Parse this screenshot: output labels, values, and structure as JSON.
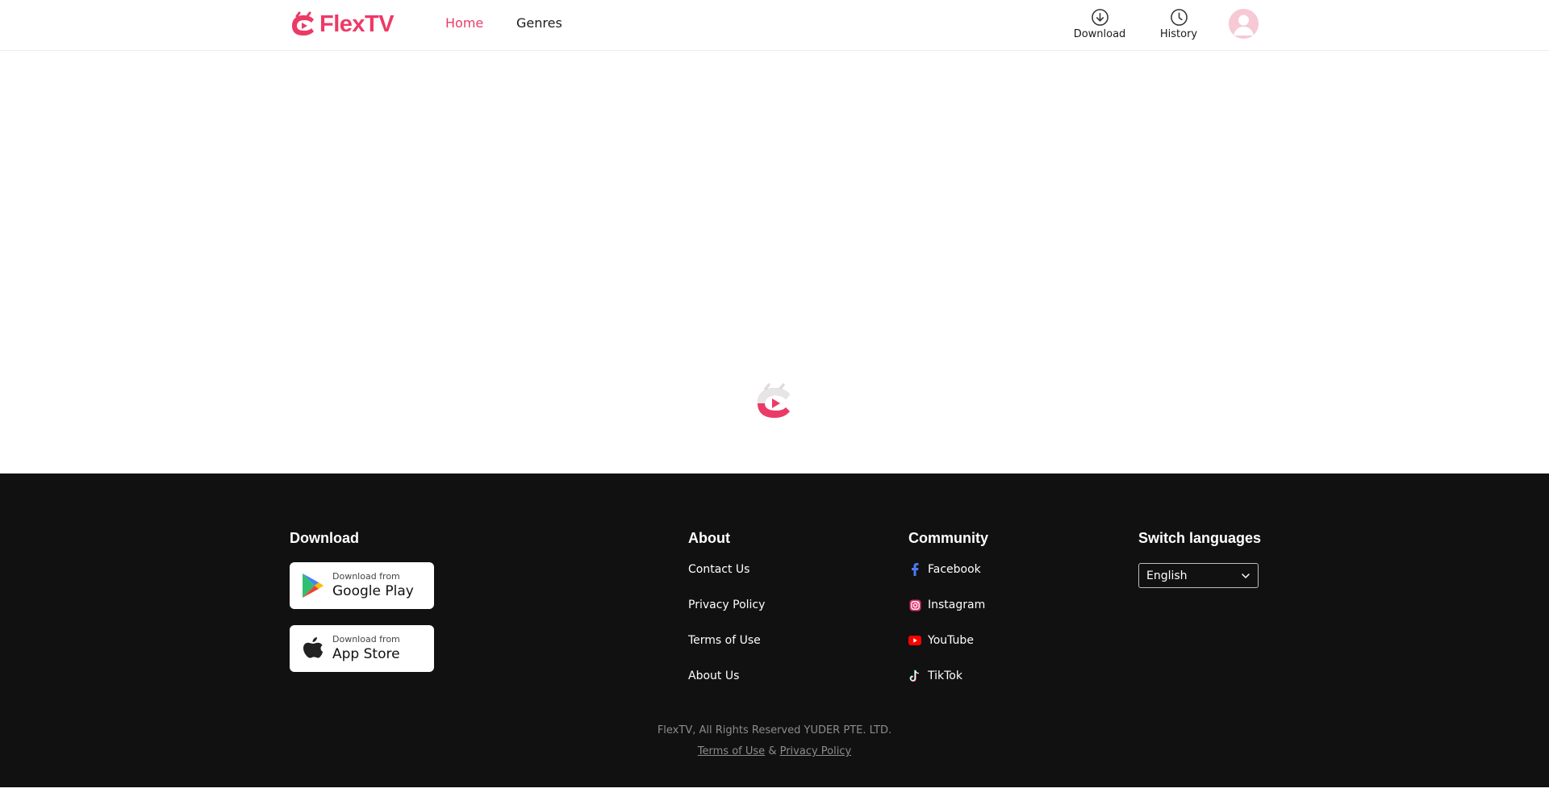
{
  "header": {
    "brand": "FlexTV",
    "nav": [
      {
        "label": "Home",
        "active": true
      },
      {
        "label": "Genres",
        "active": false
      }
    ],
    "actions": {
      "download_label": "Download",
      "history_label": "History"
    },
    "avatar_icon": "user-avatar-icon"
  },
  "loading": {
    "icon": "flextv-loading-logo-icon"
  },
  "footer": {
    "download": {
      "title": "Download",
      "google": {
        "small": "Download from",
        "big": "Google Play"
      },
      "apple": {
        "small": "Download from",
        "big": "App Store"
      }
    },
    "about": {
      "title": "About",
      "links": [
        "Contact Us",
        "Privacy Policy",
        "Terms of Use",
        "About Us"
      ]
    },
    "community": {
      "title": "Community",
      "links": [
        {
          "label": "Facebook",
          "icon": "facebook-icon"
        },
        {
          "label": "Instagram",
          "icon": "instagram-icon"
        },
        {
          "label": "YouTube",
          "icon": "youtube-icon"
        },
        {
          "label": "TikTok",
          "icon": "tiktok-icon"
        }
      ]
    },
    "languages": {
      "title": "Switch languages",
      "selected": "English"
    },
    "copyright": "FlexTV, All Rights Reserved YUDER PTE. LTD.",
    "legal": {
      "terms": "Terms of Use",
      "separator": "&",
      "privacy": "Privacy Policy"
    }
  },
  "colors": {
    "brand": "#ec3a67",
    "footer_bg": "#111111",
    "muted_text": "#8c8c8c"
  }
}
